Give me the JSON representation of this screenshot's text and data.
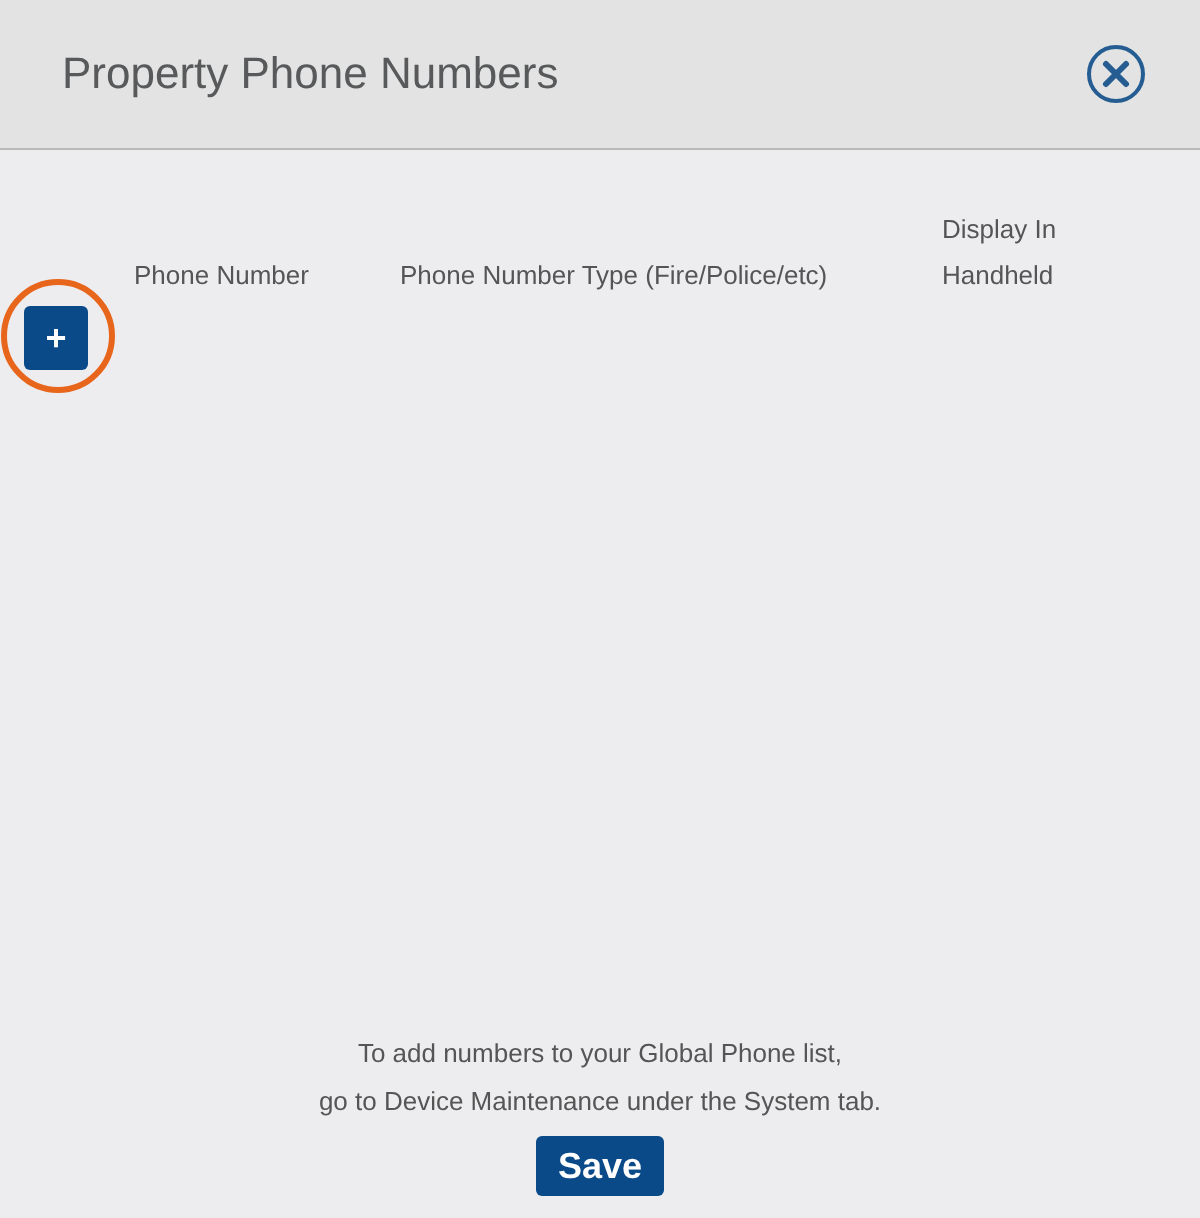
{
  "dialog": {
    "title": "Property Phone Numbers"
  },
  "table": {
    "columns": [
      {
        "label": "Phone Number"
      },
      {
        "label": "Phone Number Type (Fire/Police/etc)"
      },
      {
        "label": "Display In Handheld"
      }
    ],
    "add_button": "+"
  },
  "footer": {
    "note": "To add numbers to your Global Phone list,\ngo to Device Maintenance under the System tab.",
    "save_button": "Save"
  }
}
